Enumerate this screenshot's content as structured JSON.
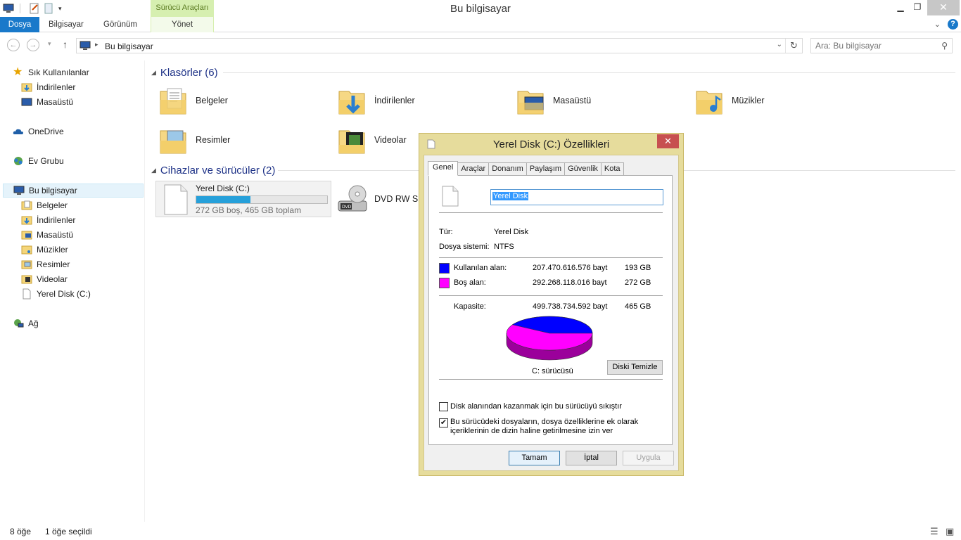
{
  "window": {
    "title": "Bu bilgisayar",
    "contextual_tab_group": "Sürücü Araçları"
  },
  "ribbon": {
    "tabs": [
      "Dosya",
      "Bilgisayar",
      "Görünüm"
    ],
    "manage_tab": "Yönet"
  },
  "address": {
    "path": "Bu bilgisayar",
    "search_placeholder": "Ara: Bu bilgisayar"
  },
  "nav": {
    "quick_access": "Sık Kullanılanlar",
    "quick_items": [
      "İndirilenler",
      "Masaüstü"
    ],
    "onedrive": "OneDrive",
    "homegroup": "Ev Grubu",
    "this_pc": "Bu bilgisayar",
    "pc_items": [
      "Belgeler",
      "İndirilenler",
      "Masaüstü",
      "Müzikler",
      "Resimler",
      "Videolar",
      "Yerel Disk (C:)"
    ],
    "network": "Ağ"
  },
  "content": {
    "folders_header": "Klasörler (6)",
    "folders": [
      "Belgeler",
      "İndirilenler",
      "Masaüstü",
      "Müzikler",
      "Resimler",
      "Videolar"
    ],
    "devices_header": "Cihazlar ve sürücüler (2)",
    "drive": {
      "name": "Yerel Disk (C:)",
      "info": "272 GB boş, 465 GB toplam",
      "used_fraction": 0.415
    },
    "dvd": "DVD RW Sür"
  },
  "status": {
    "items": "8 öğe",
    "selected": "1 öğe seçildi"
  },
  "dialog": {
    "title": "Yerel Disk (C:) Özellikleri",
    "tabs": [
      "Genel",
      "Araçlar",
      "Donanım",
      "Paylaşım",
      "Güvenlik",
      "Kota"
    ],
    "name_value": "Yerel Disk",
    "type_label": "Tür:",
    "type_value": "Yerel Disk",
    "fs_label": "Dosya sistemi:",
    "fs_value": "NTFS",
    "used_label": "Kullanılan alan:",
    "used_bytes": "207.470.616.576 bayt",
    "used_gb": "193 GB",
    "free_label": "Boş alan:",
    "free_bytes": "292.268.118.016 bayt",
    "free_gb": "272 GB",
    "capacity_label": "Kapasite:",
    "capacity_bytes": "499.738.734.592 bayt",
    "capacity_gb": "465 GB",
    "drive_caption": "C: sürücüsü",
    "cleanup_button": "Diski Temizle",
    "compress_label": "Disk alanından kazanmak için bu sürücüyü sıkıştır",
    "index_label_1": "Bu sürücüdeki dosyaların, dosya özelliklerine ek olarak",
    "index_label_2": "içeriklerinin de dizin haline getirilmesine izin ver",
    "compress_checked": false,
    "index_checked": true,
    "ok": "Tamam",
    "cancel": "İptal",
    "apply": "Uygula",
    "used_color": "#0000ff",
    "free_color": "#ff00ff",
    "used_fraction": 0.415
  }
}
